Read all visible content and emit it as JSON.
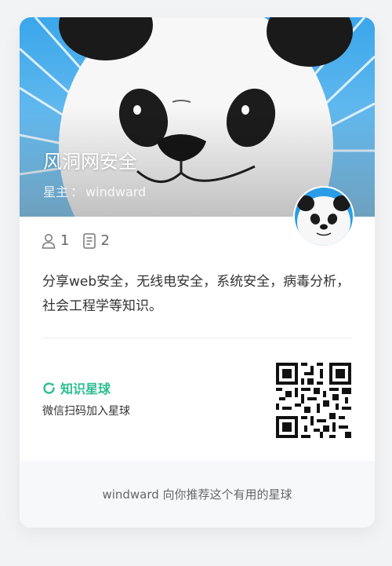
{
  "group": {
    "name": "风洞网安全",
    "owner_label": "星主",
    "owner_sep": "：",
    "owner_name": "windward",
    "member_count": "1",
    "topic_count": "2",
    "description": "分享web安全，无线电安全，系统安全，病毒分析，社会工程学等知识。"
  },
  "qr_section": {
    "brand_name": "知识星球",
    "hint": "微信扫码加入星球"
  },
  "footer": {
    "text": "windward 向你推荐这个有用的星球"
  },
  "colors": {
    "brand": "#2bbd92",
    "sky": "#2a9de6"
  },
  "icons": {
    "members": "user-icon",
    "topics": "document-icon",
    "brand": "refresh-ring-icon"
  }
}
